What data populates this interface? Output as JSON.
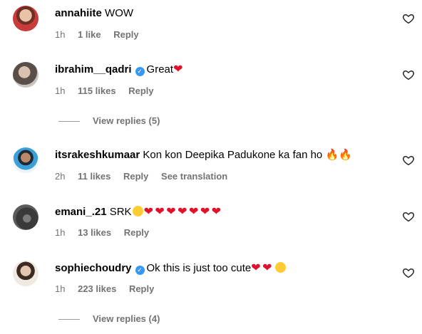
{
  "comments": [
    {
      "username": "annahiite",
      "verified": false,
      "text": "WOW",
      "emoji": "",
      "time": "1h",
      "likes": "1 like",
      "reply": "Reply",
      "translate": ""
    },
    {
      "username": "ibrahim__qadri",
      "verified": true,
      "text": "Great",
      "emoji": "❤",
      "time": "1h",
      "likes": "115 likes",
      "reply": "Reply",
      "translate": "",
      "view_replies": "View replies (5)"
    },
    {
      "username": "itsrakeshkumaar",
      "verified": false,
      "text": "Kon kon Deepika Padukone ka fan ho ",
      "emoji": "🔥🔥",
      "time": "2h",
      "likes": "11 likes",
      "reply": "Reply",
      "translate": "See translation"
    },
    {
      "username": "emani_.21",
      "verified": false,
      "text": "SRK",
      "emoji": "❤ ❤ ❤ ❤ ❤ ❤ ❤",
      "time": "1h",
      "likes": "13 likes",
      "reply": "Reply",
      "translate": ""
    },
    {
      "username": "sophiechoudry",
      "verified": true,
      "text": "Ok this is just too cute",
      "emoji": "❤ ❤",
      "time": "1h",
      "likes": "223 likes",
      "reply": "Reply",
      "translate": "",
      "view_replies": "View replies (4)"
    }
  ],
  "icons": {
    "like": "heart-outline-icon",
    "verified": "verified-badge-icon"
  },
  "colors": {
    "verified": "#3897f0",
    "meta_text": "#737373",
    "heart_emoji": "#e0112b"
  }
}
